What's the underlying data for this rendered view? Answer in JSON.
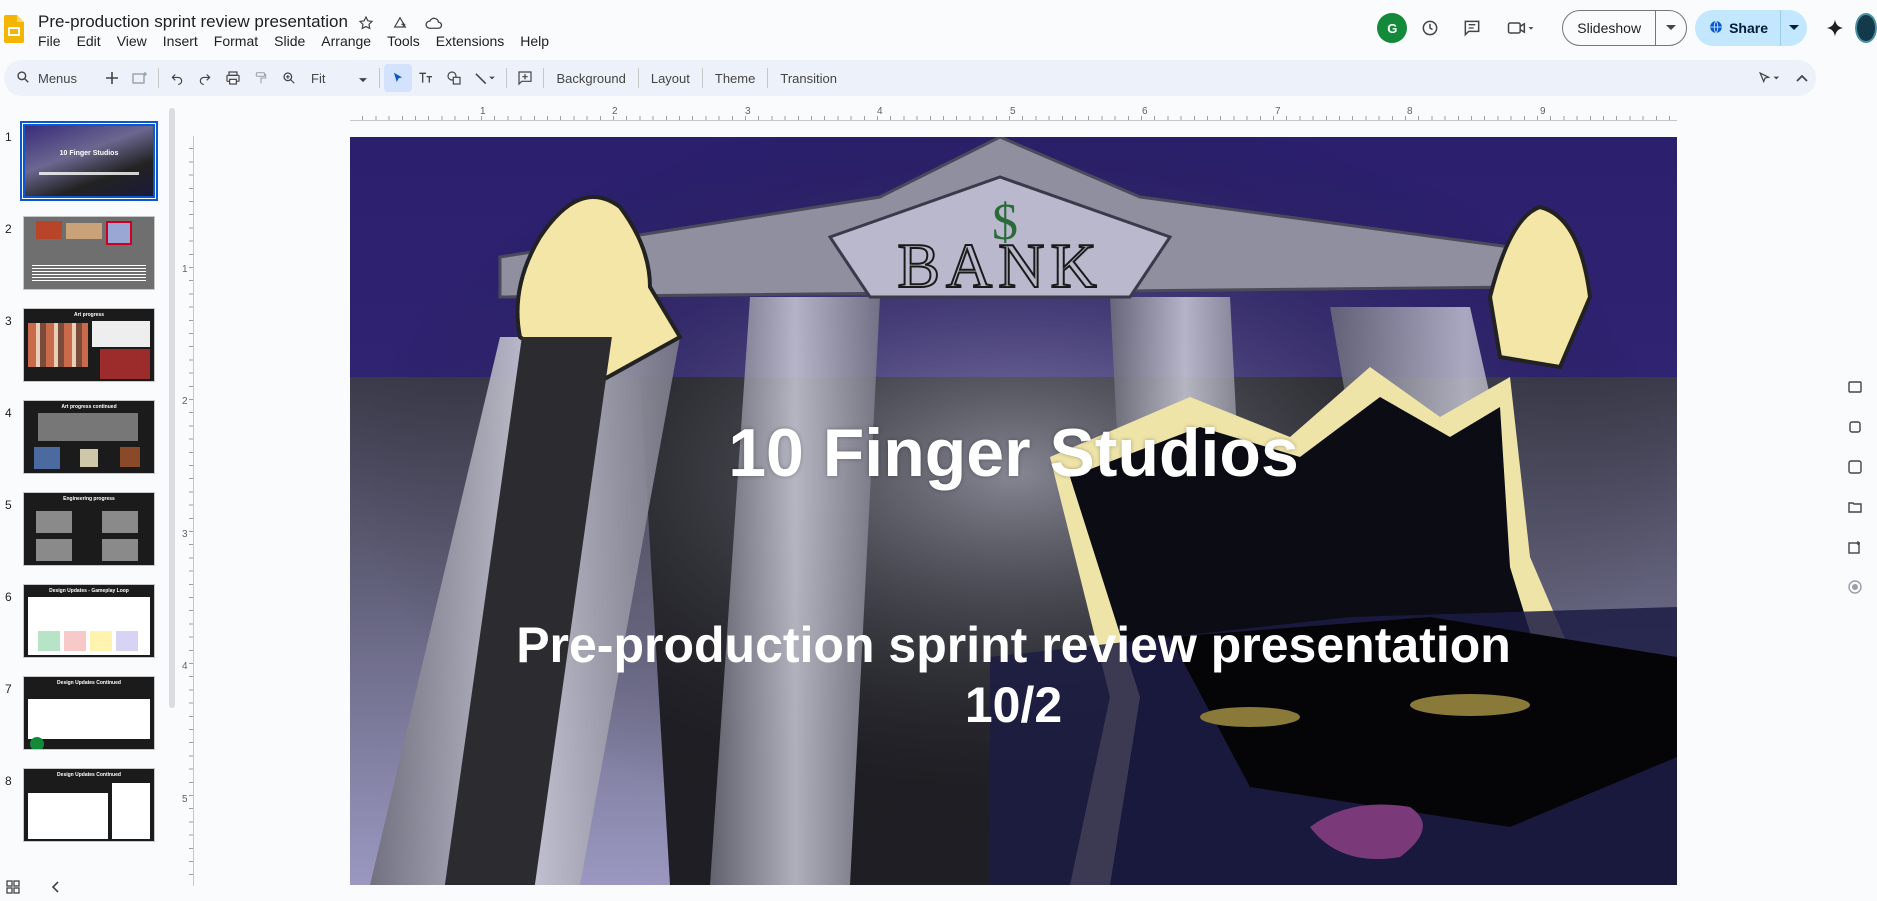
{
  "app": {
    "title": "Pre-production sprint review presentation",
    "logo_icon": "google-slides-logo-icon",
    "brand_color": "#f4b400"
  },
  "menu": [
    "File",
    "Edit",
    "View",
    "Insert",
    "Format",
    "Slide",
    "Arrange",
    "Tools",
    "Extensions",
    "Help"
  ],
  "header": {
    "avatar_initial": "G",
    "slideshow_label": "Slideshow",
    "share_label": "Share"
  },
  "toolbar": {
    "menus_label": "Menus",
    "zoom_label": "Fit",
    "background_label": "Background",
    "layout_label": "Layout",
    "theme_label": "Theme",
    "transition_label": "Transition"
  },
  "rulers": {
    "horizontal": [
      "1",
      "2",
      "3",
      "4",
      "5",
      "6",
      "7",
      "8",
      "9"
    ],
    "vertical": [
      "1",
      "2",
      "3",
      "4",
      "5"
    ]
  },
  "slides": [
    {
      "number": "1",
      "title": "10 Finger Studios",
      "selected": true
    },
    {
      "number": "2",
      "title": ""
    },
    {
      "number": "3",
      "title": "Art progress"
    },
    {
      "number": "4",
      "title": "Art progress continued"
    },
    {
      "number": "5",
      "title": "Engineering progress"
    },
    {
      "number": "6",
      "title": "Design Updates - Gameplay Loop"
    },
    {
      "number": "7",
      "title": "Design Updates Continued"
    },
    {
      "number": "8",
      "title": "Design Updates Continued"
    }
  ],
  "current_slide": {
    "title": "10 Finger Studios",
    "subtitle_line1": "Pre-production sprint review presentation",
    "subtitle_line2": "10/2",
    "sign_text": "BANK",
    "sign_symbol": "$"
  }
}
